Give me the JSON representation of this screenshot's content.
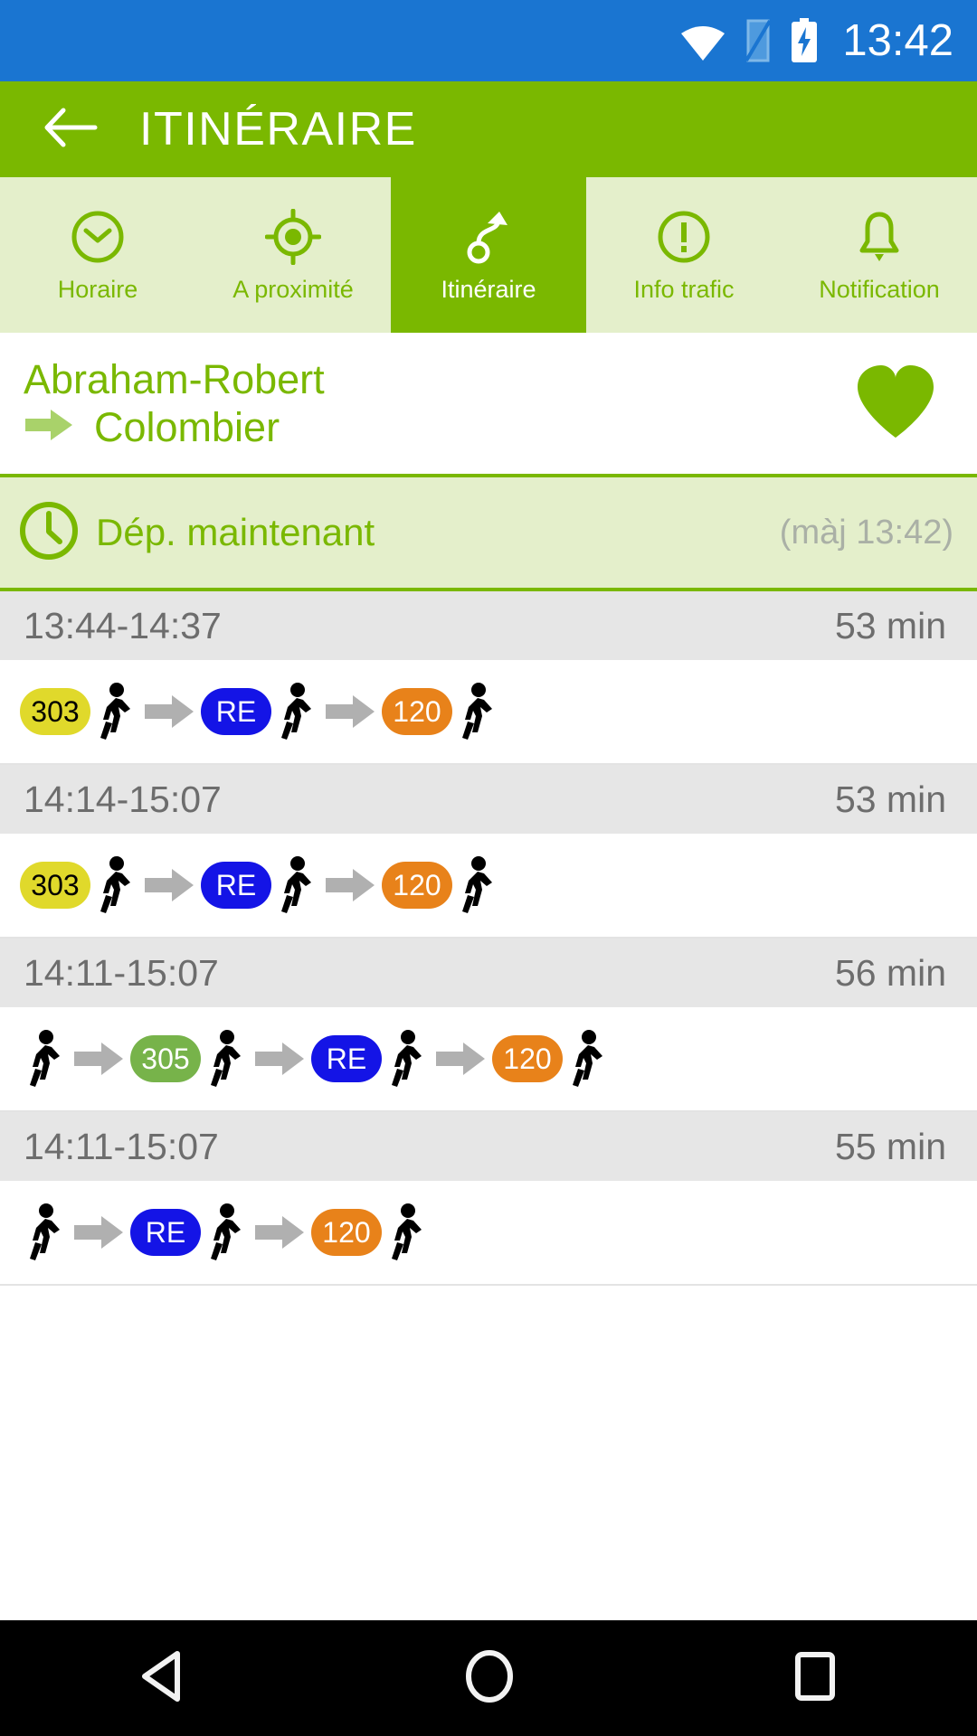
{
  "statusbar": {
    "time": "13:42",
    "background": "#1a75d1",
    "icons": [
      "wifi-icon",
      "sim-card-icon",
      "battery-charging-icon"
    ]
  },
  "appbar": {
    "title": "ITINÉRAIRE",
    "back_label": "back-arrow",
    "background": "#7ab800"
  },
  "tabs": [
    {
      "label": "Horaire",
      "icon": "clock-icon",
      "active": false
    },
    {
      "label": "A proximité",
      "icon": "location-icon",
      "active": false
    },
    {
      "label": "Itinéraire",
      "icon": "route-icon",
      "active": true
    },
    {
      "label": "Info trafic",
      "icon": "warning-icon",
      "active": false
    },
    {
      "label": "Notification",
      "icon": "bell-icon",
      "active": false
    }
  ],
  "route": {
    "from": "Abraham-Robert",
    "to": "Colombier",
    "favorite_icon": "heart-icon",
    "arrow_icon": "arrow-right-icon"
  },
  "departure": {
    "label": "Dép. maintenant",
    "updated": "(màj 13:42)",
    "icon": "clock-icon"
  },
  "journeys": [
    {
      "time_range": "13:44-14:37",
      "duration": "53 min",
      "legs": [
        {
          "type": "badge",
          "label": "303",
          "bg": "#e0d92b",
          "fg": "#000000"
        },
        {
          "type": "walk"
        },
        {
          "type": "arrow"
        },
        {
          "type": "badge",
          "label": "RE",
          "bg": "#1414e6",
          "fg": "#ffffff"
        },
        {
          "type": "walk"
        },
        {
          "type": "arrow"
        },
        {
          "type": "badge",
          "label": "120",
          "bg": "#e8821a",
          "fg": "#ffffff"
        },
        {
          "type": "walk"
        }
      ]
    },
    {
      "time_range": "14:14-15:07",
      "duration": "53 min",
      "legs": [
        {
          "type": "badge",
          "label": "303",
          "bg": "#e0d92b",
          "fg": "#000000"
        },
        {
          "type": "walk"
        },
        {
          "type": "arrow"
        },
        {
          "type": "badge",
          "label": "RE",
          "bg": "#1414e6",
          "fg": "#ffffff"
        },
        {
          "type": "walk"
        },
        {
          "type": "arrow"
        },
        {
          "type": "badge",
          "label": "120",
          "bg": "#e8821a",
          "fg": "#ffffff"
        },
        {
          "type": "walk"
        }
      ]
    },
    {
      "time_range": "14:11-15:07",
      "duration": "56 min",
      "legs": [
        {
          "type": "walk"
        },
        {
          "type": "arrow"
        },
        {
          "type": "badge",
          "label": "305",
          "bg": "#77b34a",
          "fg": "#ffffff"
        },
        {
          "type": "walk"
        },
        {
          "type": "arrow"
        },
        {
          "type": "badge",
          "label": "RE",
          "bg": "#1414e6",
          "fg": "#ffffff"
        },
        {
          "type": "walk"
        },
        {
          "type": "arrow"
        },
        {
          "type": "badge",
          "label": "120",
          "bg": "#e8821a",
          "fg": "#ffffff"
        },
        {
          "type": "walk"
        }
      ]
    },
    {
      "time_range": "14:11-15:07",
      "duration": "55 min",
      "legs": [
        {
          "type": "walk"
        },
        {
          "type": "arrow"
        },
        {
          "type": "badge",
          "label": "RE",
          "bg": "#1414e6",
          "fg": "#ffffff"
        },
        {
          "type": "walk"
        },
        {
          "type": "arrow"
        },
        {
          "type": "badge",
          "label": "120",
          "bg": "#e8821a",
          "fg": "#ffffff"
        },
        {
          "type": "walk"
        }
      ]
    }
  ],
  "navbar": {
    "back": "back-triangle-icon",
    "home": "home-circle-icon",
    "recents": "recents-square-icon"
  },
  "colors": {
    "brand_green": "#7ab800",
    "tab_bg": "#e4efcb",
    "status_blue": "#1a75d1",
    "row_head": "#e6e6e6"
  }
}
